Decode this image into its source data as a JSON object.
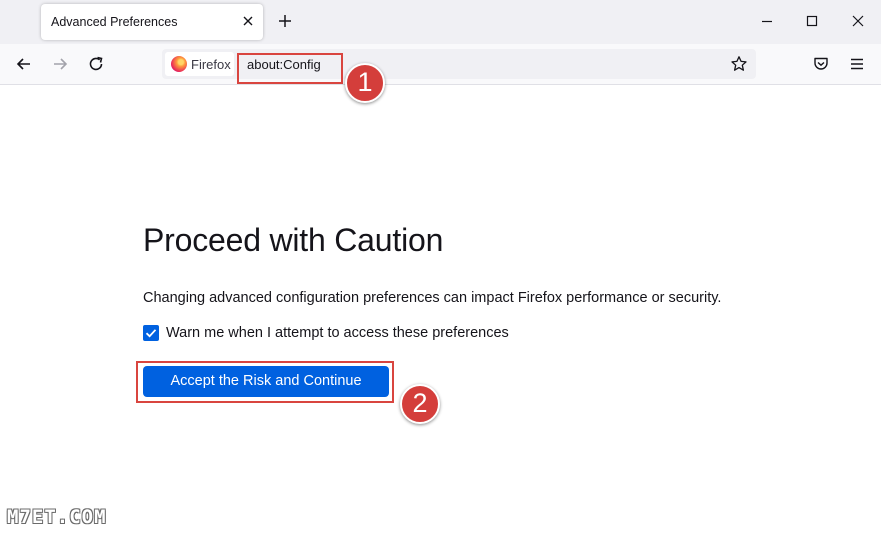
{
  "tab": {
    "title": "Advanced Preferences"
  },
  "urlbar": {
    "identity_label": "Firefox",
    "url": "about:Config"
  },
  "annotations": {
    "step1": "1",
    "step2": "2"
  },
  "page": {
    "heading": "Proceed with Caution",
    "description": "Changing advanced configuration preferences can impact Firefox performance or security.",
    "checkbox_label": "Warn me when I attempt to access these preferences",
    "checkbox_checked": true,
    "accept_button": "Accept the Risk and Continue"
  },
  "watermark": "M7ET.COM",
  "colors": {
    "accent": "#0061e0",
    "annotation": "#d43e3b",
    "toolbar": "#f9f9fb",
    "tabstrip": "#f0f0f4"
  },
  "icons": [
    "close-icon",
    "plus-icon",
    "minimize-icon",
    "maximize-icon",
    "back-icon",
    "forward-icon",
    "reload-icon",
    "firefox-logo-icon",
    "star-icon",
    "pocket-icon",
    "menu-icon",
    "checkmark-icon"
  ]
}
